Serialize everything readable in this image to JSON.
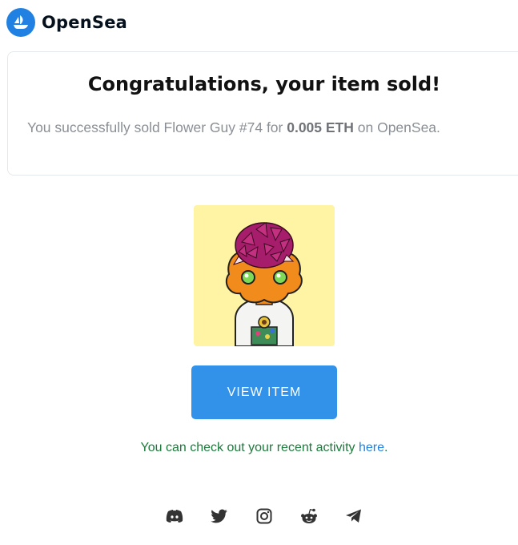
{
  "header": {
    "brand_name": "OpenSea",
    "logo_icon": "opensea-logo-icon"
  },
  "card": {
    "title": "Congratulations, your item sold!",
    "message_prefix": "You successfully sold Flower Guy #74 for ",
    "price": "0.005 ETH",
    "message_suffix": " on OpenSea."
  },
  "nft": {
    "image_icon": "nft-flower-guy-image",
    "background_color": "#fff4a3"
  },
  "cta": {
    "view_item_label": "VIEW ITEM",
    "button_color": "#3291e9"
  },
  "activity": {
    "text_prefix": "You can check out your recent activity ",
    "link_text": "here",
    "text_suffix": "."
  },
  "social": {
    "icons": [
      "discord-icon",
      "twitter-icon",
      "instagram-icon",
      "reddit-icon",
      "telegram-icon"
    ]
  },
  "colors": {
    "brand_blue": "#2081e2",
    "activity_green": "#1c7b3c"
  }
}
